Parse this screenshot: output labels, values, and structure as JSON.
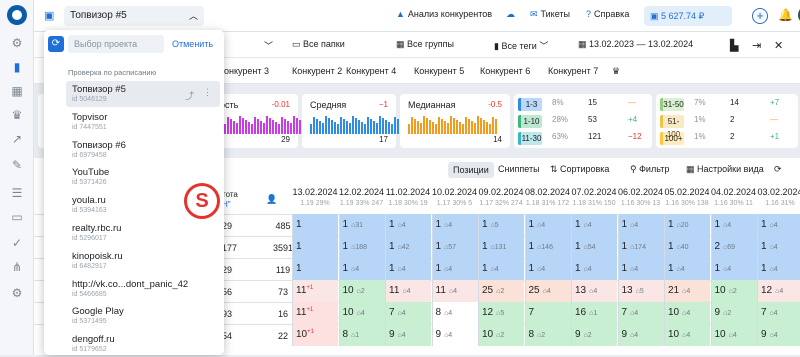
{
  "header": {
    "project_label": "Топвизор #5",
    "analyze": "Анализ конкурентов",
    "tickets": "Тикеты",
    "help": "Справка",
    "balance": "5 627.74 ₽"
  },
  "toolbar2": {
    "folders": "Все папки",
    "groups": "Все группы",
    "tags": "Все теги",
    "date_range": "13.02.2023 — 13.02.2024"
  },
  "competitors": [
    "онкурент 3",
    "Конкурент 2",
    "Конкурент 4",
    "Конкурент 5",
    "Конкурент 6",
    "Конкурент 7"
  ],
  "stats": {
    "cards": [
      {
        "title": "ость",
        "delta": "-0.01",
        "value": "29"
      },
      {
        "title": "Средняя",
        "delta": "−1",
        "value": "17"
      },
      {
        "title": "Медианная",
        "delta": "-0.5",
        "value": "14"
      }
    ],
    "dist_left": [
      {
        "range": "1-3",
        "color": "#2f8be8",
        "pct": "8%",
        "count": "15",
        "change": "—"
      },
      {
        "range": "1-10",
        "color": "#3cb878",
        "pct": "28%",
        "count": "53",
        "change": "+4"
      },
      {
        "range": "11-30",
        "color": "#39b7c4",
        "pct": "63%",
        "count": "121",
        "change": "−12"
      }
    ],
    "dist_right": [
      {
        "range": "31-50",
        "color": "#8fd17b",
        "pct": "7%",
        "count": "14",
        "change": "+7"
      },
      {
        "range": "51-100",
        "color": "#f0c14b",
        "pct": "1%",
        "count": "2",
        "change": "—"
      },
      {
        "range": "100+",
        "color": "#ffc63a",
        "pct": "1%",
        "count": "2",
        "change": "+1"
      }
    ]
  },
  "panel": {
    "positions": "Позиции",
    "snippets": "Сниппеты",
    "sort": "Сортировка",
    "filter": "Фильтр",
    "view": "Настройки вида",
    "freq": "тота",
    "freq2": "Н\""
  },
  "dates": [
    {
      "d": "13.02.2024",
      "s": "1.19  29%"
    },
    {
      "d": "12.02.2024",
      "s": "1.19  33%  247"
    },
    {
      "d": "11.02.2024",
      "s": "1.18  30%  19"
    },
    {
      "d": "10.02.2024",
      "s": "1.17  30%  5"
    },
    {
      "d": "09.02.2024",
      "s": "1.17  32%  274"
    },
    {
      "d": "08.02.2024",
      "s": "1.18  31%  172"
    },
    {
      "d": "07.02.2024",
      "s": "1.18  31%  150"
    },
    {
      "d": "06.02.2024",
      "s": "1.16  30%  13"
    },
    {
      "d": "05.02.2024",
      "s": "1.16  30%  138"
    },
    {
      "d": "04.02.2024",
      "s": "1.16  30%  11"
    },
    {
      "d": "03.02.2024",
      "s": "1.16  31%"
    }
  ],
  "rows": [
    {
      "check": "✓",
      "freq": "29",
      "v": "485",
      "bg": "blue",
      "cells": [
        [
          "1",
          ""
        ],
        [
          "1",
          "31"
        ],
        [
          "1",
          "4"
        ],
        [
          "1",
          "4"
        ],
        [
          "1",
          "5"
        ],
        [
          "1",
          "4"
        ],
        [
          "1",
          "4"
        ],
        [
          "1",
          "4"
        ],
        [
          "1",
          "20"
        ],
        [
          "1",
          "4"
        ],
        [
          "1",
          "4"
        ]
      ]
    },
    {
      "check": "✓",
      "freq": "177",
      "v": "3591",
      "bg": "blue",
      "cells": [
        [
          "1",
          ""
        ],
        [
          "1",
          "188"
        ],
        [
          "1",
          "42"
        ],
        [
          "1",
          "57"
        ],
        [
          "1",
          "131"
        ],
        [
          "1",
          "146"
        ],
        [
          "1",
          "54"
        ],
        [
          "1",
          "174"
        ],
        [
          "1",
          "40"
        ],
        [
          "2",
          "69"
        ],
        [
          "1",
          "4"
        ]
      ]
    },
    {
      "check": "✕",
      "freq": "29",
      "v": "119",
      "bg": "blue",
      "cells": [
        [
          "1",
          ""
        ],
        [
          "1",
          "4"
        ],
        [
          "1",
          "4"
        ],
        [
          "1",
          "4"
        ],
        [
          "1",
          "4"
        ],
        [
          "1",
          "4"
        ],
        [
          "1",
          "4"
        ],
        [
          "1",
          "4"
        ],
        [
          "1",
          "4"
        ],
        [
          "1",
          "4"
        ],
        [
          "1",
          "4"
        ]
      ]
    },
    {
      "check": "✓",
      "freq": "56",
      "v": "73",
      "bg": "mixed",
      "cells": [
        [
          "11",
          "+1"
        ],
        [
          "10",
          "2"
        ],
        [
          "11",
          "4"
        ],
        [
          "11",
          "4"
        ],
        [
          "25",
          "2"
        ],
        [
          "25",
          "4"
        ],
        [
          "13",
          "4"
        ],
        [
          "13",
          "5"
        ],
        [
          "21",
          "4"
        ],
        [
          "10",
          "2"
        ],
        [
          "12",
          "4"
        ]
      ]
    },
    {
      "check": "✓",
      "freq": "93",
      "v": "16",
      "bg": "green",
      "cells": [
        [
          "11",
          "+1"
        ],
        [
          "10",
          "4"
        ],
        [
          "7",
          "4"
        ],
        [
          "8",
          "4"
        ],
        [
          "12",
          "5"
        ],
        [
          "7",
          ""
        ],
        [
          "16",
          "1"
        ],
        [
          "7",
          "4"
        ],
        [
          "10",
          "4"
        ],
        [
          "9",
          "2"
        ],
        [
          "7",
          "4"
        ]
      ]
    },
    {
      "check": "✓",
      "freq": "54",
      "v": "22",
      "bg": "green",
      "cells": [
        [
          "10",
          "+1"
        ],
        [
          "8",
          "1"
        ],
        [
          "9",
          "4"
        ],
        [
          "9",
          "4"
        ],
        [
          "10",
          "2"
        ],
        [
          "8",
          "2"
        ],
        [
          "9",
          "2"
        ],
        [
          "9",
          "4"
        ],
        [
          "10",
          "4"
        ],
        [
          "10",
          "4"
        ],
        [
          "9",
          "4"
        ]
      ]
    }
  ],
  "dropdown": {
    "search_placeholder": "Выбор проекта",
    "cancel": "Отменить",
    "section": "Проверка по расписанию",
    "items": [
      {
        "name": "Топвизор #5",
        "id": "id 5046129"
      },
      {
        "name": "Topvisor",
        "id": "id 7447551"
      },
      {
        "name": "Топвизор #6",
        "id": "id 6979458"
      },
      {
        "name": "YouTube",
        "id": "id 5371426"
      },
      {
        "name": "youla.ru",
        "id": "id 5394163"
      },
      {
        "name": "realty.rbc.ru",
        "id": "id 5296017"
      },
      {
        "name": "kinopoisk.ru",
        "id": "id 6482917"
      },
      {
        "name": "http://vk.co...dont_panic_42",
        "id": "id 5466685"
      },
      {
        "name": "Google Play",
        "id": "id 5371495"
      },
      {
        "name": "dengoff.ru",
        "id": "id 5179652"
      }
    ]
  },
  "logo_letter": "S"
}
